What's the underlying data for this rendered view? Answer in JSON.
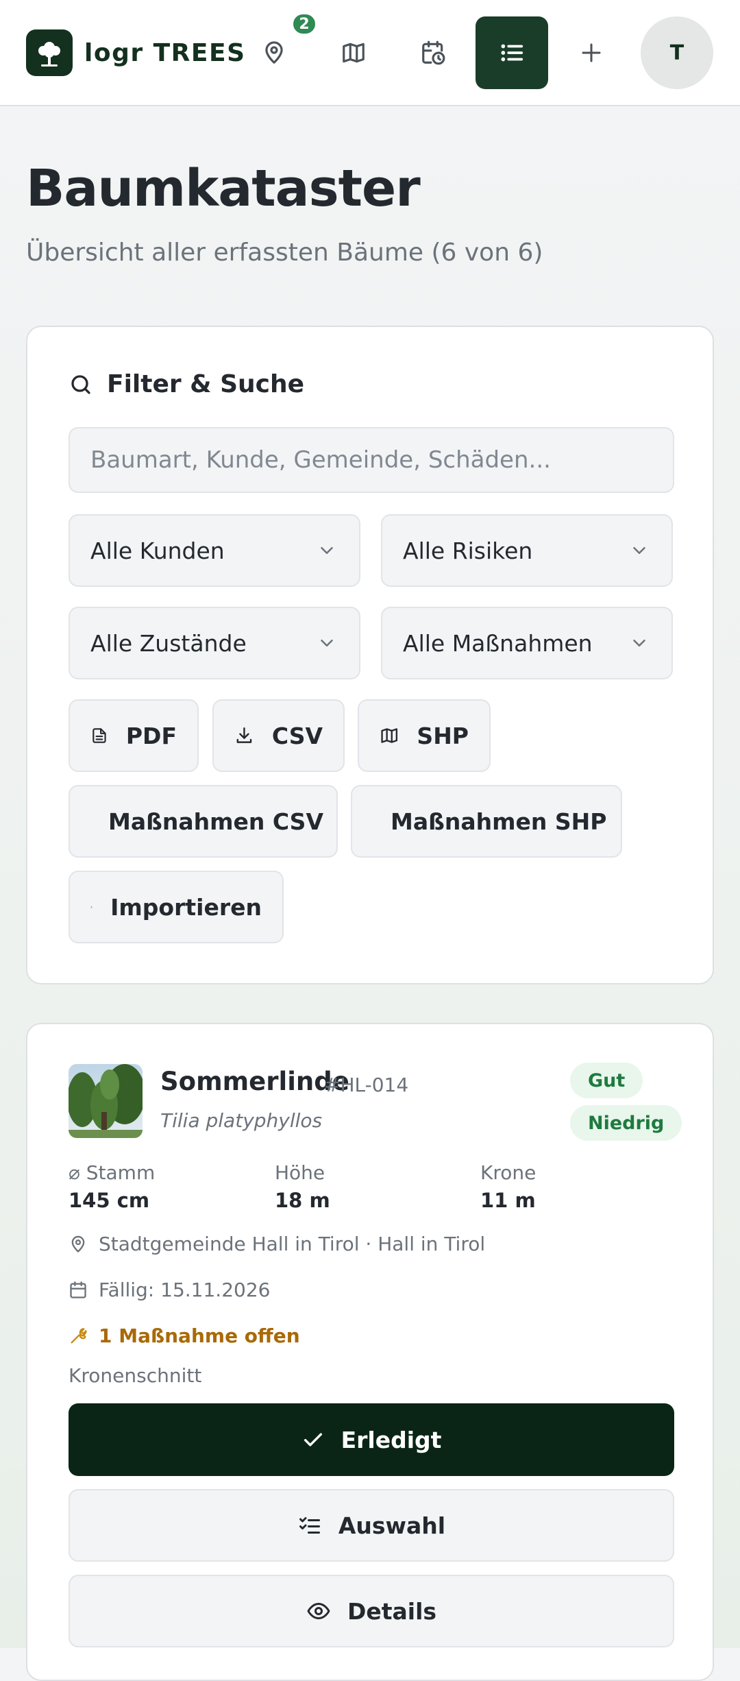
{
  "app": {
    "brand_name": "logr TREES",
    "accent_color": "#1a3d29",
    "primary_button_color": "#0a2515"
  },
  "nav": {
    "items": [
      {
        "icon": "map-pin-icon",
        "badge": "2"
      },
      {
        "icon": "map-icon"
      },
      {
        "icon": "calendar-clock-icon"
      },
      {
        "icon": "list-icon",
        "active": true
      },
      {
        "icon": "plus-icon"
      }
    ],
    "avatar_initial": "T"
  },
  "header": {
    "title": "Baumkataster",
    "subtitle": "Übersicht aller erfassten Bäume (6 von 6)"
  },
  "filter": {
    "title": "Filter & Suche",
    "search_placeholder": "Baumart, Kunde, Gemeinde, Schäden...",
    "search_value": "",
    "selects": {
      "customers": "Alle Kunden",
      "risks": "Alle Risiken",
      "conditions": "Alle Zustände",
      "measures": "Alle Maßnahmen"
    },
    "actions": {
      "pdf": "PDF",
      "csv": "CSV",
      "shp": "SHP",
      "measures_csv": "Maßnahmen CSV",
      "measures_shp": "Maßnahmen SHP",
      "import": "Importieren"
    }
  },
  "tree": {
    "name": "Sommerlinde",
    "id": "#HL-014",
    "latin": "Tilia platyphyllos",
    "condition_badge": "Gut",
    "risk_badge": "Niedrig",
    "stats": [
      {
        "label": "⌀ Stamm",
        "value": "145 cm"
      },
      {
        "label": "Höhe",
        "value": "18 m"
      },
      {
        "label": "Krone",
        "value": "11 m"
      }
    ],
    "location": "Stadtgemeinde Hall in Tirol · Hall in Tirol",
    "due": "Fällig: 15.11.2026",
    "open_measures": "1 Maßnahme offen",
    "measure_name": "Kronenschnitt",
    "buttons": {
      "done": "Erledigt",
      "select": "Auswahl",
      "details": "Details"
    }
  }
}
